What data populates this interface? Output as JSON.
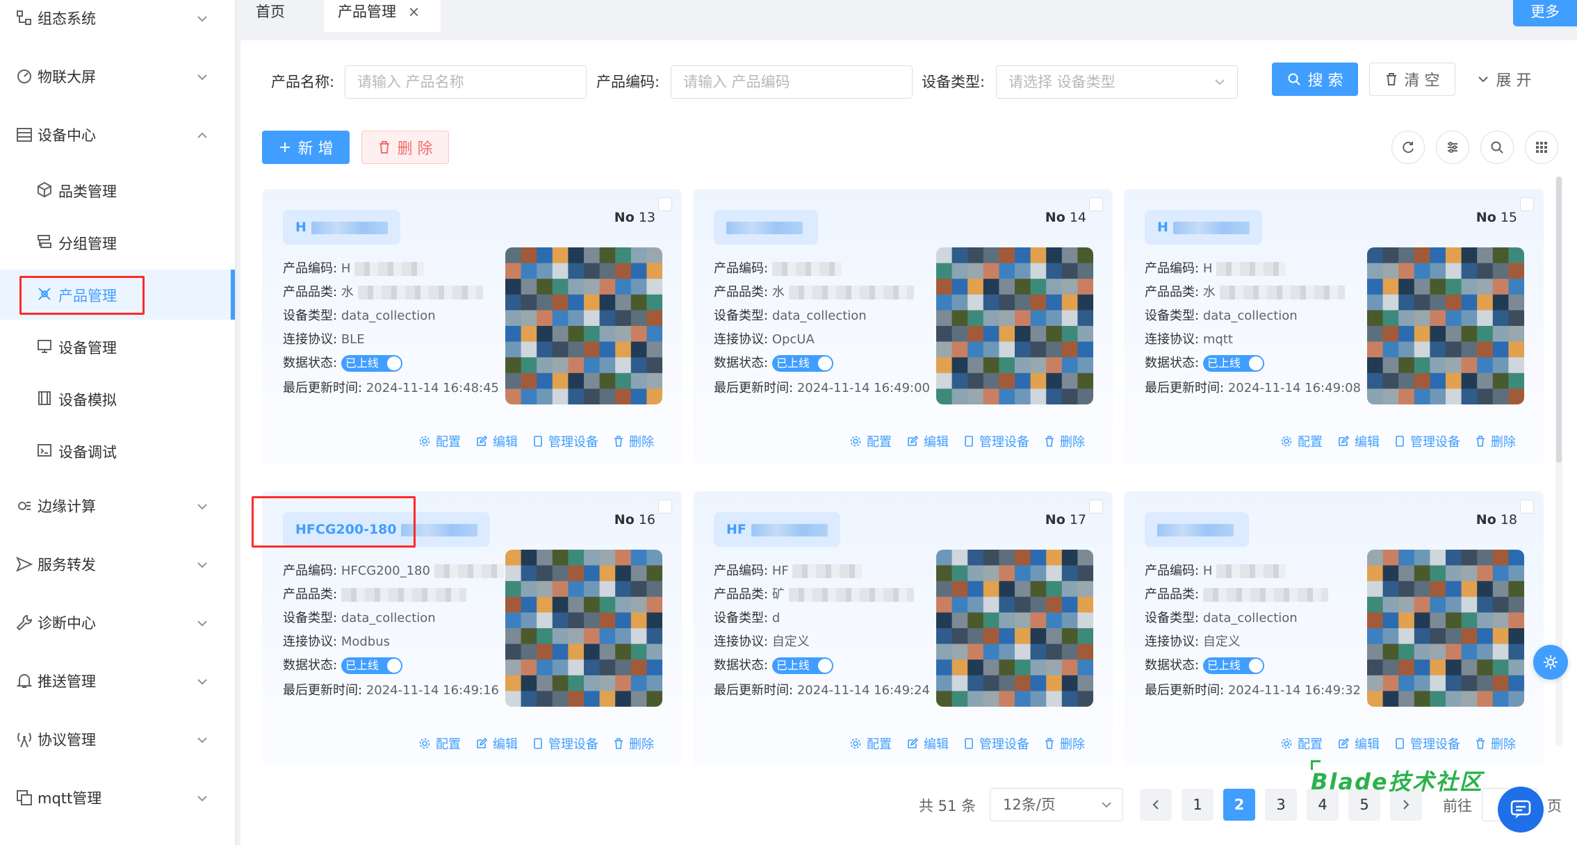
{
  "sidebar": {
    "groups": [
      {
        "label": "组态系统",
        "icon": "flow-icon",
        "expanded": false
      },
      {
        "label": "物联大屏",
        "icon": "screen-icon",
        "expanded": false
      },
      {
        "label": "设备中心",
        "icon": "device-center-icon",
        "expanded": true
      },
      {
        "label": "边缘计算",
        "icon": "edge-icon",
        "expanded": false
      },
      {
        "label": "服务转发",
        "icon": "forward-icon",
        "expanded": false
      },
      {
        "label": "诊断中心",
        "icon": "wrench-icon",
        "expanded": false
      },
      {
        "label": "推送管理",
        "icon": "bell-icon",
        "expanded": false
      },
      {
        "label": "协议管理",
        "icon": "antenna-icon",
        "expanded": false
      },
      {
        "label": "mqtt管理",
        "icon": "copy-icon",
        "expanded": false
      }
    ],
    "sub_items": [
      {
        "label": "品类管理",
        "icon": "cube-icon",
        "active": false
      },
      {
        "label": "分组管理",
        "icon": "group-icon",
        "active": false
      },
      {
        "label": "产品管理",
        "icon": "product-icon",
        "active": true
      },
      {
        "label": "设备管理",
        "icon": "monitor-icon",
        "active": false
      },
      {
        "label": "设备模拟",
        "icon": "film-icon",
        "active": false
      },
      {
        "label": "设备调试",
        "icon": "debug-icon",
        "active": false
      }
    ]
  },
  "tabs": {
    "home": "首页",
    "current": "产品管理",
    "close": "×",
    "more": "更多"
  },
  "search": {
    "name_label": "产品名称:",
    "name_placeholder": "请输入 产品名称",
    "code_label": "产品编码:",
    "code_placeholder": "请输入 产品编码",
    "type_label": "设备类型:",
    "type_placeholder": "请选择 设备类型",
    "search_btn": "搜 索",
    "clear_btn": "清 空",
    "expand_btn": "展 开"
  },
  "toolbar": {
    "add_btn": "新 增",
    "delete_btn": "删 除"
  },
  "card_labels": {
    "code": "产品编码:",
    "category": "产品品类:",
    "device_type": "设备类型:",
    "protocol": "连接协议:",
    "status": "数据状态:",
    "updated": "最后更新时间:",
    "no": "No",
    "online": "已上线",
    "action_config": "配置",
    "action_edit": "编辑",
    "action_manage": "管理设备",
    "action_delete": "删除"
  },
  "cards": [
    {
      "name": "H",
      "no": "13",
      "code": "H",
      "category": "水",
      "device_type": "data_collection",
      "protocol": "BLE",
      "updated": "2024-11-14 16:48:45"
    },
    {
      "name": "",
      "no": "14",
      "code": "",
      "category": "水",
      "device_type": "data_collection",
      "protocol": "OpcUA",
      "updated": "2024-11-14 16:49:00"
    },
    {
      "name": "H",
      "no": "15",
      "code": "H",
      "category": "水",
      "device_type": "data_collection",
      "protocol": "mqtt",
      "updated": "2024-11-14 16:49:08"
    },
    {
      "name": "HFCG200-180",
      "no": "16",
      "code": "HFCG200_180",
      "category": "",
      "device_type": "data_collection",
      "protocol": "Modbus",
      "updated": "2024-11-14 16:49:16"
    },
    {
      "name": "HF",
      "no": "17",
      "code": "HF",
      "category": "矿",
      "device_type": "d",
      "protocol": "自定义",
      "updated": "2024-11-14 16:49:24"
    },
    {
      "name": "",
      "no": "18",
      "code": "H",
      "category": "",
      "device_type": "data_collection",
      "protocol": "自定义",
      "updated": "2024-11-14 16:49:32"
    }
  ],
  "pagination": {
    "total": "共 51 条",
    "page_size": "12条/页",
    "pages": [
      "1",
      "2",
      "3",
      "4",
      "5"
    ],
    "current": "2",
    "goto": "前往",
    "page_unit": "页"
  },
  "watermark": "Blade技术社区",
  "colors": {
    "primary": "#409eff",
    "danger": "#f56c6c",
    "highlight_box": "#ff2a2a"
  }
}
